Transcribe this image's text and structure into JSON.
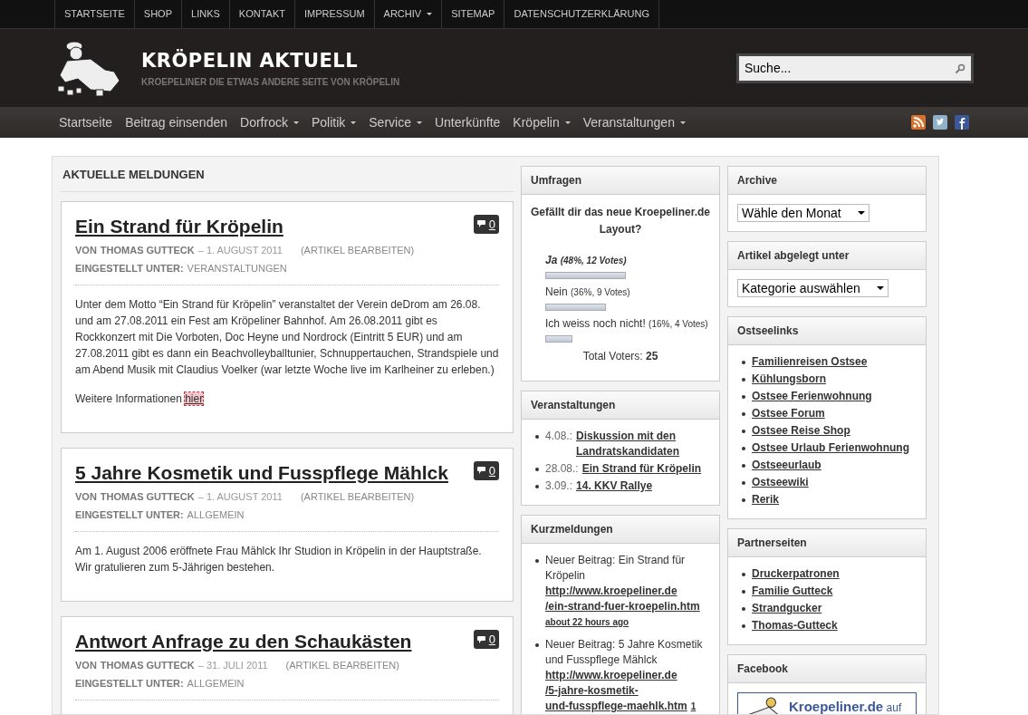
{
  "top_menu": [
    {
      "label": "STARTSEITE",
      "dropdown": false
    },
    {
      "label": "SHOP",
      "dropdown": false
    },
    {
      "label": "LINKS",
      "dropdown": false
    },
    {
      "label": "KONTAKT",
      "dropdown": false
    },
    {
      "label": "IMPRESSUM",
      "dropdown": false
    },
    {
      "label": "ARCHIV",
      "dropdown": true
    },
    {
      "label": "SITEMAP",
      "dropdown": false
    },
    {
      "label": "DATENSCHUTZERKLÄRUNG",
      "dropdown": false
    }
  ],
  "site": {
    "title": "KRÖPELIN AKTUELL",
    "tagline": "KROEPELINER DIE ETWAS ANDERE SEITE VON KRÖPELIN"
  },
  "search": {
    "placeholder": "Suche..."
  },
  "main_nav": [
    {
      "label": "Startseite",
      "dropdown": false
    },
    {
      "label": "Beitrag einsenden",
      "dropdown": false
    },
    {
      "label": "Dorfrock",
      "dropdown": true
    },
    {
      "label": "Politik",
      "dropdown": true
    },
    {
      "label": "Service",
      "dropdown": true
    },
    {
      "label": "Unterkünfte",
      "dropdown": false
    },
    {
      "label": "Kröpelin",
      "dropdown": true
    },
    {
      "label": "Veranstaltungen",
      "dropdown": true
    }
  ],
  "main": {
    "heading": "AKTUELLE MELDUNGEN",
    "posts": [
      {
        "title": "Ein Strand für Kröpelin",
        "comments": "0",
        "by": "VON",
        "author": "THOMAS GUTTECK",
        "date": "– 1. AUGUST 2011",
        "edit": "(ARTIKEL BEARBEITEN)",
        "category_label": "EINGESTELLT UNTER:",
        "category": "VERANSTALTUNGEN",
        "paragraphs": [
          {
            "text": "Unter dem Motto “Ein Strand für Kröpelin” veranstaltet der Verein deDrom am 26.08. und am 27.08.2011 ein Fest am Kröpeliner Bahnhof. Am 26.08.2011 gibt es Rockkonzert mit Die Vorboten, Doc Heyne und Nordrock (Eintritt 5 EUR) und am 27.08.2011 gibt es dann ein Beachvolleyballtunier, Schnuppertauchen, Strandspiele und am Abend Musik mit Claudius Voelker (war letzte Woche live im Karlheiner zu erleben.)"
          },
          {
            "text": "Weitere Informationen",
            "link": "hier",
            "focused": true
          }
        ]
      },
      {
        "title": "5 Jahre Kosmetik und Fusspflege Mählck",
        "comments": "0",
        "by": "VON",
        "author": "THOMAS GUTTECK",
        "date": "– 1. AUGUST 2011",
        "edit": "(ARTIKEL BEARBEITEN)",
        "category_label": "EINGESTELLT UNTER:",
        "category": "ALLGEMEIN",
        "paragraphs": [
          {
            "text": "Am 1. August 2006 eröffnete Frau Mählck Ihr Studion in Kröpelin in der Hauptstraße. Wir gratulieren zum 5-Jährigen bestehen."
          }
        ]
      },
      {
        "title": "Antwort Anfrage zu den Schaukästen",
        "comments": "0",
        "by": "VON",
        "author": "THOMAS GUTTECK",
        "date": "– 31. JULI 2011",
        "edit": "(ARTIKEL BEARBEITEN)",
        "category_label": "EINGESTELLT UNTER:",
        "category": "ALLGEMEIN"
      }
    ]
  },
  "poll": {
    "title": "Umfragen",
    "question": "Gefällt dir das neue Kroepeliner.de Layout?",
    "options": [
      {
        "label": "Ja",
        "detail": "(48%, 12 Votes)",
        "leading": true,
        "level": 0.48
      },
      {
        "label": "Nein",
        "detail": "(36%, 9 Votes)",
        "leading": false,
        "level": 0.36
      },
      {
        "label": "Ich weiss noch nicht!",
        "detail": "(16%, 4 Votes)",
        "leading": false,
        "level": 0.16
      }
    ],
    "total_label": "Total Voters:",
    "total": "25"
  },
  "events": {
    "title": "Veranstaltungen",
    "items": [
      {
        "date": "4.08.:",
        "title": "Diskussion mit den Landratskandidaten"
      },
      {
        "date": "28.08.:",
        "title": "Ein Strand für Kröpelin"
      },
      {
        "date": "3.09.:",
        "title": "14. KKV Rallye"
      }
    ]
  },
  "news": {
    "title": "Kurzmeldungen",
    "items": [
      {
        "text": "Neuer Beitrag: Ein Strand für Kröpelin",
        "url_parts": [
          "http://www.kroepeliner.de",
          "/ein-strand-fuer-kroepelin.htm"
        ],
        "time": "about 22 hours ago"
      },
      {
        "text": "Neuer Beitrag: 5 Jahre Kosmetik und Fusspflege Mählck",
        "url_parts": [
          "http://www.kroepeliner.de",
          "/5-jahre-kosmetik-",
          "und-fusspflege-maehlk.htm"
        ],
        "time": "1"
      }
    ]
  },
  "archive": {
    "title": "Archive",
    "select": "Wähle den Monat"
  },
  "categories": {
    "title": "Artikel abgelegt unter",
    "select": "Kategorie auswählen"
  },
  "link_lists": [
    {
      "title": "Ostseelinks",
      "links": [
        "Familienreisen Ostsee",
        "Kühlungsborn",
        "Ostsee Ferienwohnung",
        "Ostsee Forum",
        "Ostsee Reise Shop",
        "Ostsee Urlaub Ferienwohnung",
        "Ostseeurlaub",
        "Ostseewiki",
        "Rerik"
      ]
    },
    {
      "title": "Partnerseiten",
      "links": [
        "Druckerpatronen",
        "Familie Gutteck",
        "Strandgucker",
        "Thomas-Gutteck"
      ]
    }
  ],
  "facebook": {
    "title": "Facebook",
    "page": "Kroepeliner.de",
    "suffix": "auf"
  }
}
